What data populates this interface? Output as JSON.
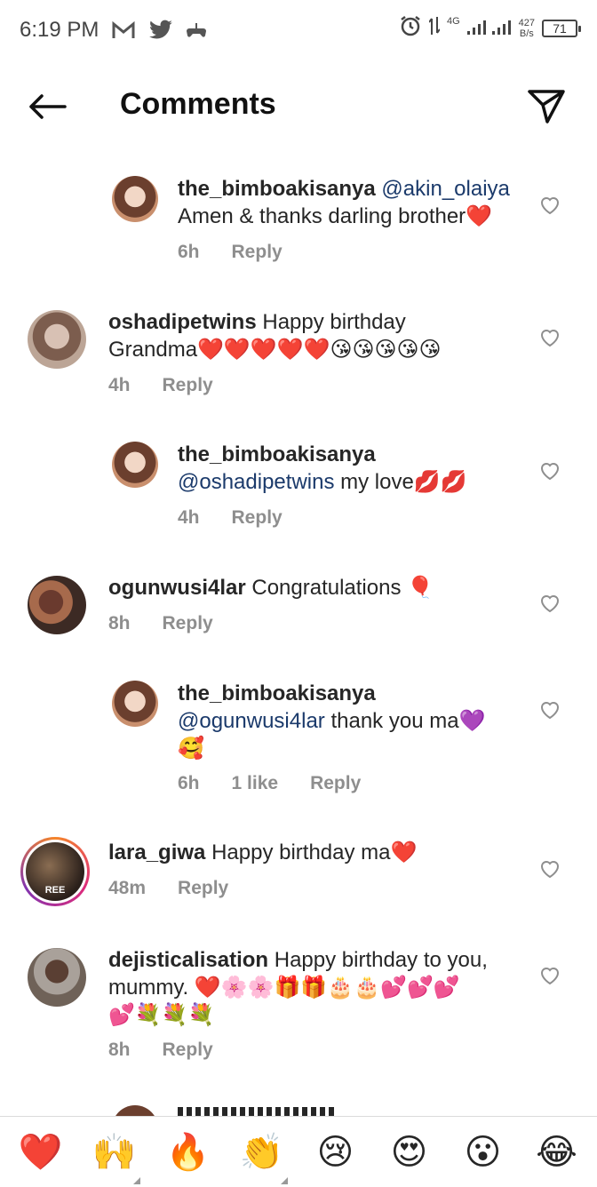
{
  "status_bar": {
    "time": "6:19 PM",
    "net_speed_top": "427",
    "net_speed_bottom": "B/s",
    "battery": "71",
    "network": "4G",
    "icons": [
      "gmail-icon",
      "twitter-icon",
      "game-icon",
      "alarm-icon",
      "signal-icon"
    ]
  },
  "header": {
    "title": "Comments"
  },
  "comments": [
    {
      "username": "the_bimboakisanya",
      "mention": "@akin_olaiya",
      "text_line1": "",
      "text_line2": "Amen & thanks darling brother❤️",
      "time": "6h",
      "likes": "",
      "reply": "Reply"
    },
    {
      "username": "oshadipetwins",
      "text_line1": " Happy birthday",
      "text_line2": "Grandma❤️❤️❤️❤️❤️😘😘😘😘😘",
      "time": "4h",
      "reply": "Reply"
    },
    {
      "username": "the_bimboakisanya",
      "mention": "@oshadipetwins",
      "text_line2": " my love💋💋",
      "time": "4h",
      "reply": "Reply"
    },
    {
      "username": "ogunwusi4lar",
      "text_line1": " Congratulations 🎈",
      "time": "8h",
      "reply": "Reply"
    },
    {
      "username": "the_bimboakisanya",
      "mention": "@ogunwusi4lar",
      "text_line2": " thank you ma💜",
      "text_line3": "🥰",
      "time": "6h",
      "likes": "1 like",
      "reply": "Reply"
    },
    {
      "username": "lara_giwa",
      "text_line1": " Happy birthday ma❤️",
      "time": "48m",
      "reply": "Reply",
      "avatar_text": "REE"
    },
    {
      "username": "dejisticalisation",
      "text_line1": " Happy birthday to you,",
      "text_line2": "mummy. ❤️🌸🌸🎁🎁🎂🎂💕💕💕",
      "text_line3": "💕💐💐💐",
      "time": "8h",
      "reply": "Reply"
    }
  ],
  "emoji_bar": [
    "❤️",
    "🙌",
    "🔥",
    "👏",
    "😢",
    "😍",
    "😮",
    "😂"
  ]
}
